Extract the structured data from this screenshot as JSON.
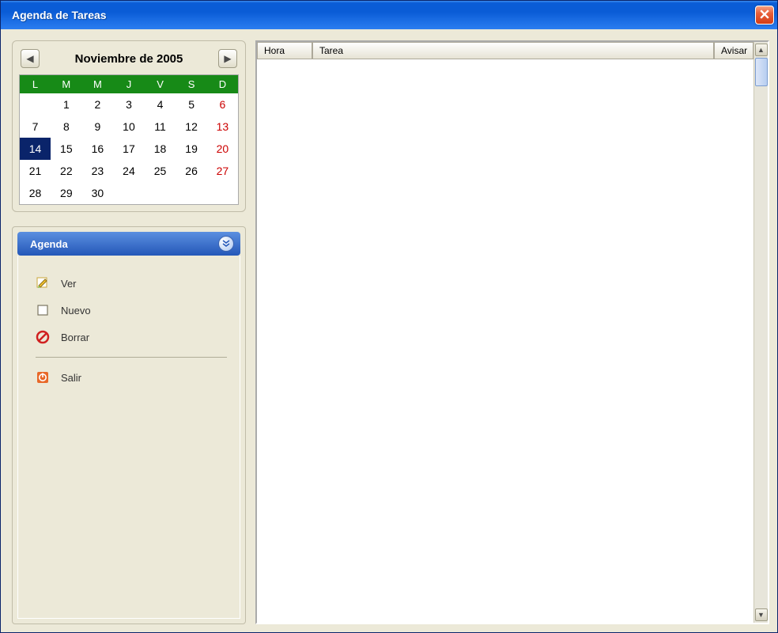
{
  "window": {
    "title": "Agenda de Tareas"
  },
  "calendar": {
    "title": "Noviembre de 2005",
    "dow": [
      "L",
      "M",
      "M",
      "J",
      "V",
      "S",
      "D"
    ],
    "selected_day": 14,
    "weeks": [
      [
        "",
        "1",
        "2",
        "3",
        "4",
        "5",
        "6"
      ],
      [
        "7",
        "8",
        "9",
        "10",
        "11",
        "12",
        "13"
      ],
      [
        "14",
        "15",
        "16",
        "17",
        "18",
        "19",
        "20"
      ],
      [
        "21",
        "22",
        "23",
        "24",
        "25",
        "26",
        "27"
      ],
      [
        "28",
        "29",
        "30",
        "",
        "",
        "",
        ""
      ]
    ]
  },
  "agenda": {
    "title": "Agenda",
    "items": {
      "ver": "Ver",
      "nuevo": "Nuevo",
      "borrar": "Borrar",
      "salir": "Salir"
    }
  },
  "table": {
    "columns": {
      "hora": "Hora",
      "tarea": "Tarea",
      "avisar": "Avisar"
    },
    "rows": []
  }
}
